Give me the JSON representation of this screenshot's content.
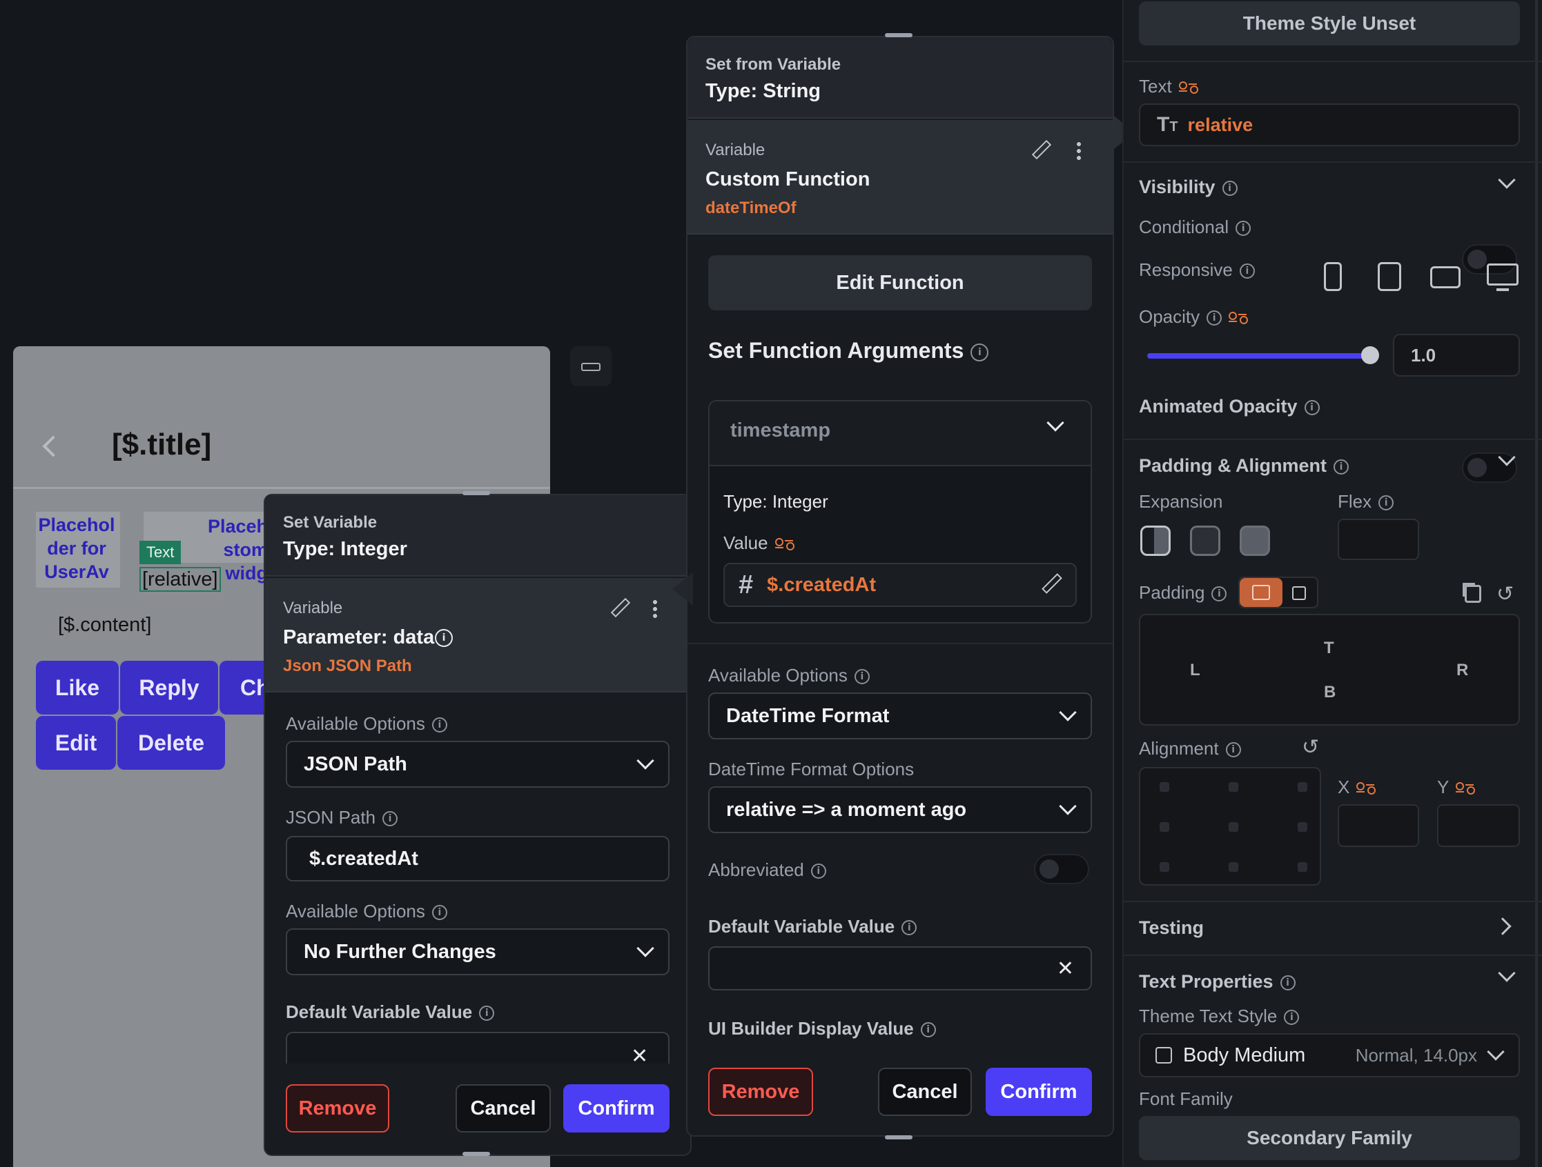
{
  "canvas": {
    "page_title": "[$.title]",
    "avatar_placeholder": "Placehol der for UserAv",
    "custom_widget_placeholder": "Placeh stom widg",
    "text_tag": "Text",
    "relative_text": "[relative]",
    "content_text": "[$.content]",
    "buttons": [
      "Like",
      "Reply",
      "Ch",
      "Edit",
      "Delete"
    ]
  },
  "left_panel": {
    "header_label": "Set Variable",
    "header_type": "Type: Integer",
    "variable_label": "Variable",
    "variable_value": "Parameter: data",
    "variable_source": "Json JSON Path",
    "available_options_label": "Available Options",
    "available_options_value": "JSON Path",
    "json_path_label": "JSON Path",
    "json_path_value": "$.createdAt",
    "available_options2_label": "Available Options",
    "available_options2_value": "No Further Changes",
    "default_value_label": "Default Variable Value",
    "default_value": "",
    "remove": "Remove",
    "cancel": "Cancel",
    "confirm": "Confirm"
  },
  "mid_panel": {
    "header_label": "Set from Variable",
    "header_type": "Type: String",
    "variable_label": "Variable",
    "variable_value": "Custom Function",
    "variable_source": "dateTimeOf",
    "edit_function": "Edit Function",
    "set_args_title": "Set Function Arguments",
    "arg_name": "timestamp",
    "arg_type": "Type: Integer",
    "value_label": "Value",
    "arg_value": "$.createdAt",
    "available_options_label": "Available Options",
    "available_options_value": "DateTime Format",
    "datetime_options_label": "DateTime Format Options",
    "datetime_options_value": "relative => a moment ago",
    "abbreviated_label": "Abbreviated",
    "default_value_label": "Default Variable Value",
    "default_value": "",
    "ui_builder_label": "UI Builder Display Value",
    "remove": "Remove",
    "cancel": "Cancel",
    "confirm": "Confirm"
  },
  "properties": {
    "theme_style": "Theme Style Unset",
    "text_label": "Text",
    "text_value": "relative",
    "visibility": "Visibility",
    "conditional": "Conditional",
    "responsive": "Responsive",
    "opacity": "Opacity",
    "opacity_value": "1.0",
    "opacity_level": 0.98,
    "animated_opacity": "Animated Opacity",
    "padding_alignment": "Padding & Alignment",
    "expansion": "Expansion",
    "flex": "Flex",
    "padding": "Padding",
    "pad_t": "T",
    "pad_l": "L",
    "pad_r": "R",
    "pad_b": "B",
    "alignment": "Alignment",
    "x_label": "X",
    "y_label": "Y",
    "testing": "Testing",
    "text_properties": "Text Properties",
    "theme_text_style": "Theme Text Style",
    "text_style_value": "Body Medium",
    "text_style_detail": "Normal, 14.0px",
    "font_family_label": "Font Family",
    "font_family_value": "Secondary Family"
  }
}
